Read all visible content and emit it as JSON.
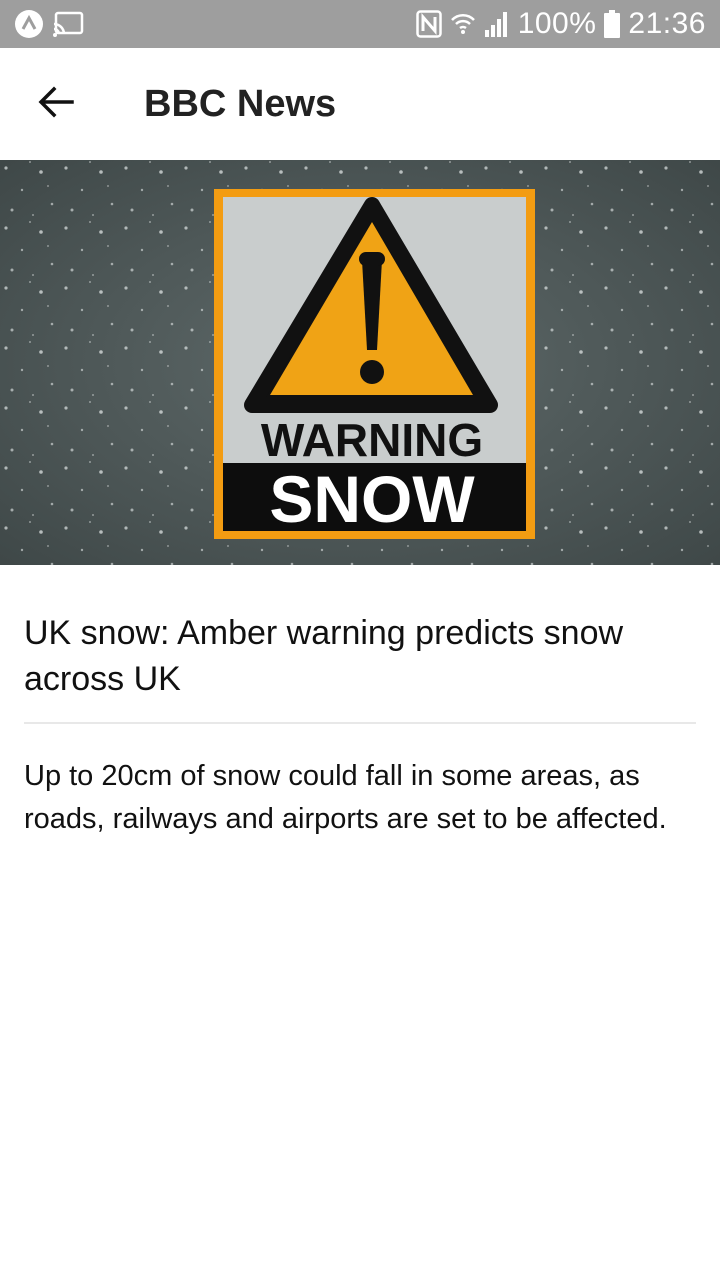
{
  "status_bar": {
    "battery": "100%",
    "time": "21:36",
    "icons": [
      "app-notification-icon",
      "cast-icon",
      "nfc-icon",
      "wifi-icon",
      "signal-icon",
      "battery-icon"
    ]
  },
  "app_bar": {
    "title": "BBC News",
    "back_icon": "arrow-left-icon"
  },
  "hero": {
    "sign_line1": "WARNING",
    "sign_line2": "SNOW",
    "colors": {
      "border": "#f39c12",
      "triangle": "#f0a315",
      "background": "#4e5858"
    }
  },
  "article": {
    "headline": "UK snow: Amber warning predicts snow across UK",
    "summary": "Up to 20cm of snow could fall in some areas, as roads, railways and airports are set to be affected."
  }
}
